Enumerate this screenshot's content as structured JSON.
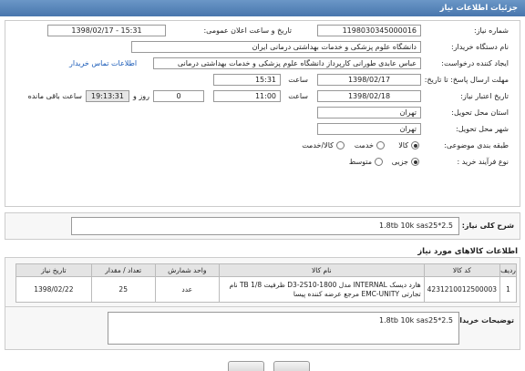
{
  "header": {
    "title": "جزئیات اطلاعات نیاز"
  },
  "form": {
    "need_number_label": "شماره نیاز:",
    "need_number": "1198030345000016",
    "announce_label": "تاریخ و ساعت اعلان عمومی:",
    "announce_value": "1398/02/17 - 15:31",
    "buyer_org_label": "نام دستگاه خریدار:",
    "buyer_org": "دانشگاه علوم پزشکی و خدمات بهداشتی درمانی ایران",
    "creator_label": "ایجاد کننده درخواست:",
    "creator": "عباس عابدی طورانی کارپرداز دانشگاه علوم پزشکی و خدمات بهداشتی درمانی",
    "contact_link": "اطلاعات تماس خریدار",
    "send_deadline_label": "مهلت ارسال پاسخ: تا تاریخ:",
    "send_date": "1398/02/17",
    "time_label": "ساعت",
    "send_time": "15:31",
    "validity_label": "تاریخ اعتبار نیاز:",
    "validity_date": "1398/02/18",
    "validity_time": "11:00",
    "days_remaining": "0",
    "day_and_label": "روز و",
    "countdown": "19:13:31",
    "remaining_label": "ساعت باقی مانده",
    "province_label": "استان محل تحویل:",
    "province": "تهران",
    "city_label": "شهر محل تحویل:",
    "city": "تهران",
    "category_label": "طبقه بندی موضوعی:",
    "category_options": [
      "کالا",
      "خدمت",
      "کالا/خدمت"
    ],
    "process_label": "نوع فرآیند خرید :",
    "process_options": [
      "جزیی",
      "متوسط"
    ]
  },
  "summary": {
    "label": "شرح کلی نیاز:",
    "value": "1.8tb 10k sas25*2.5"
  },
  "goods": {
    "title": "اطلاعات کالاهای مورد نیاز",
    "columns": [
      "ردیف",
      "کد کالا",
      "نام کالا",
      "واحد شمارش",
      "تعداد / مقدار",
      "تاریخ نیاز"
    ],
    "rows": [
      {
        "row": "1",
        "code": "4231210012500003",
        "name": "هارد دیسک INTERNAL مدل D3-2S10-1800 ظرفیت 1/8 TB نام تجارتی EMC-UNITY مرجع عرضه کننده پیسا",
        "unit": "عدد",
        "qty": "25",
        "date": "1398/02/22"
      }
    ]
  },
  "buyer_notes": {
    "label": "توضیحات خریدار:",
    "value": "1.8tb 10k sas25*2.5"
  }
}
